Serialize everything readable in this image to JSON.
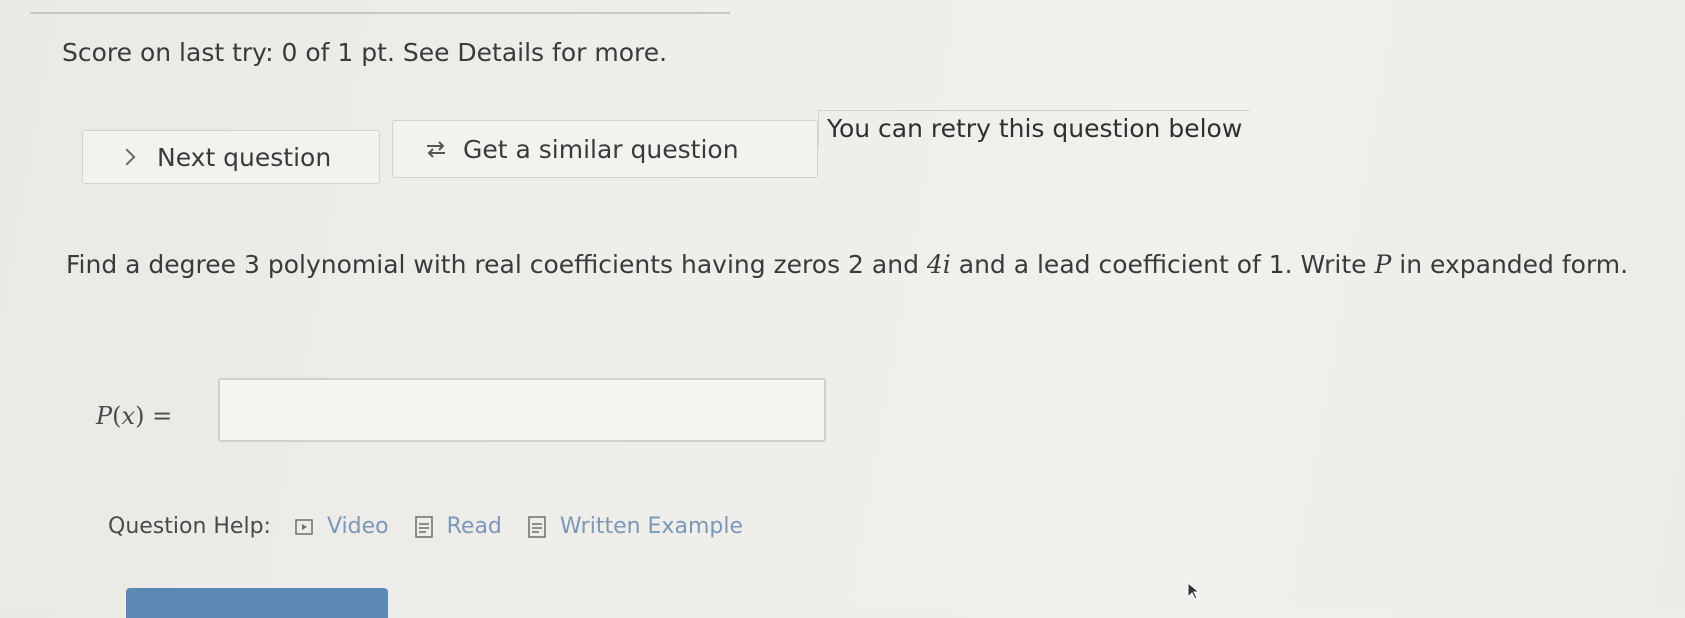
{
  "score": {
    "text": "Score on last try: 0 of 1 pt. See Details for more."
  },
  "actions": {
    "next_label": "Next question",
    "similar_label": "Get a similar question",
    "retry_text": "You can retry this question below"
  },
  "question": {
    "text_part1": "Find a degree 3 polynomial with real coefficients having zeros 2 and ",
    "zero_complex": "4i",
    "text_part2": " and a lead coefficient of 1. Write ",
    "poly_symbol": "P",
    "text_part3": " in expanded form."
  },
  "answer": {
    "label_func": "P",
    "label_paren_open": "(",
    "label_var": "x",
    "label_rest": ") =",
    "value": "",
    "placeholder": ""
  },
  "help": {
    "label": "Question Help:",
    "video_label": "Video",
    "read_label": "Read",
    "example_label": "Written Example"
  },
  "icons": {
    "next": "chevron-right-icon",
    "similar": "repeat-arrows-icon",
    "video": "video-play-icon",
    "read": "document-icon",
    "example": "document-icon"
  },
  "colors": {
    "link": "#7c98b8",
    "footer_button": "#5b88b3"
  }
}
